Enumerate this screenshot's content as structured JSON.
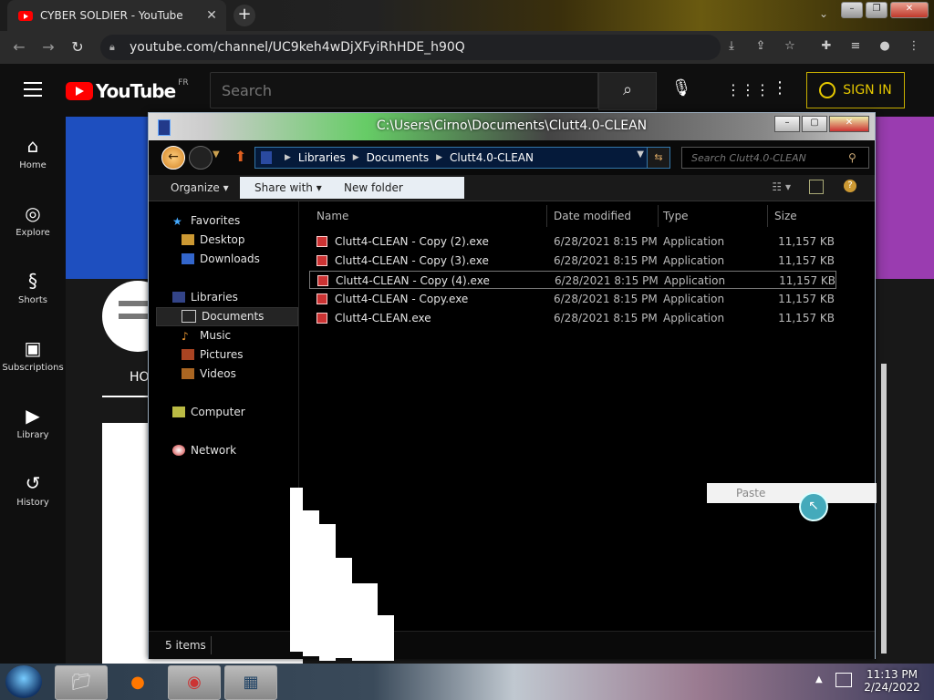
{
  "browser": {
    "tab_title": "CYBER SOLDIER - YouTube",
    "tab_close": "✕",
    "new_tab": "+",
    "url": "youtube.com/channel/UC9keh4wDjXFyiRhHDE_h90Q",
    "icons": [
      "back-icon",
      "forward-icon",
      "reload-icon",
      "lock-icon",
      "download-icon",
      "share-icon",
      "star-icon",
      "extensions-icon",
      "playlist-icon",
      "profile-icon",
      "menu-icon"
    ]
  },
  "youtube": {
    "logo_text": "YouTube",
    "country_code": "FR",
    "search_placeholder": "Search",
    "sign_in": "SIGN IN",
    "sidebar": [
      {
        "label": "Home",
        "icon": "home-icon"
      },
      {
        "label": "Explore",
        "icon": "compass-icon"
      },
      {
        "label": "Shorts",
        "icon": "shorts-icon"
      },
      {
        "label": "Subscriptions",
        "icon": "subscriptions-icon"
      },
      {
        "label": "Library",
        "icon": "library-icon"
      },
      {
        "label": "History",
        "icon": "history-icon"
      }
    ],
    "channel_tab_partial": "HO"
  },
  "explorer": {
    "title_path": "C:\\Users\\Cirno\\Documents\\Clutt4.0-CLEAN",
    "breadcrumb": [
      "Libraries",
      "Documents",
      "Clutt4.0-CLEAN"
    ],
    "search_placeholder": "Search Clutt4.0-CLEAN",
    "commands": {
      "organize": "Organize",
      "share_with": "Share with",
      "new_folder": "New folder"
    },
    "nav": {
      "favorites": "Favorites",
      "desktop": "Desktop",
      "downloads": "Downloads",
      "libraries": "Libraries",
      "documents": "Documents",
      "music": "Music",
      "pictures": "Pictures",
      "videos": "Videos",
      "computer": "Computer",
      "network": "Network"
    },
    "columns": {
      "name": "Name",
      "date": "Date modified",
      "type": "Type",
      "size": "Size"
    },
    "files": [
      {
        "name": "Clutt4-CLEAN - Copy (2).exe",
        "date": "6/28/2021 8:15 PM",
        "type": "Application",
        "size": "11,157 KB"
      },
      {
        "name": "Clutt4-CLEAN - Copy (3).exe",
        "date": "6/28/2021 8:15 PM",
        "type": "Application",
        "size": "11,157 KB"
      },
      {
        "name": "Clutt4-CLEAN - Copy (4).exe",
        "date": "6/28/2021 8:15 PM",
        "type": "Application",
        "size": "11,157 KB"
      },
      {
        "name": "Clutt4-CLEAN - Copy.exe",
        "date": "6/28/2021 8:15 PM",
        "type": "Application",
        "size": "11,157 KB"
      },
      {
        "name": "Clutt4-CLEAN.exe",
        "date": "6/28/2021 8:15 PM",
        "type": "Application",
        "size": "11,157 KB"
      }
    ],
    "status_count": "5 items",
    "context_menu": {
      "paste": "Paste"
    }
  },
  "taskbar": {
    "clock_time": "11:13 PM",
    "clock_date": "2/24/2022"
  }
}
